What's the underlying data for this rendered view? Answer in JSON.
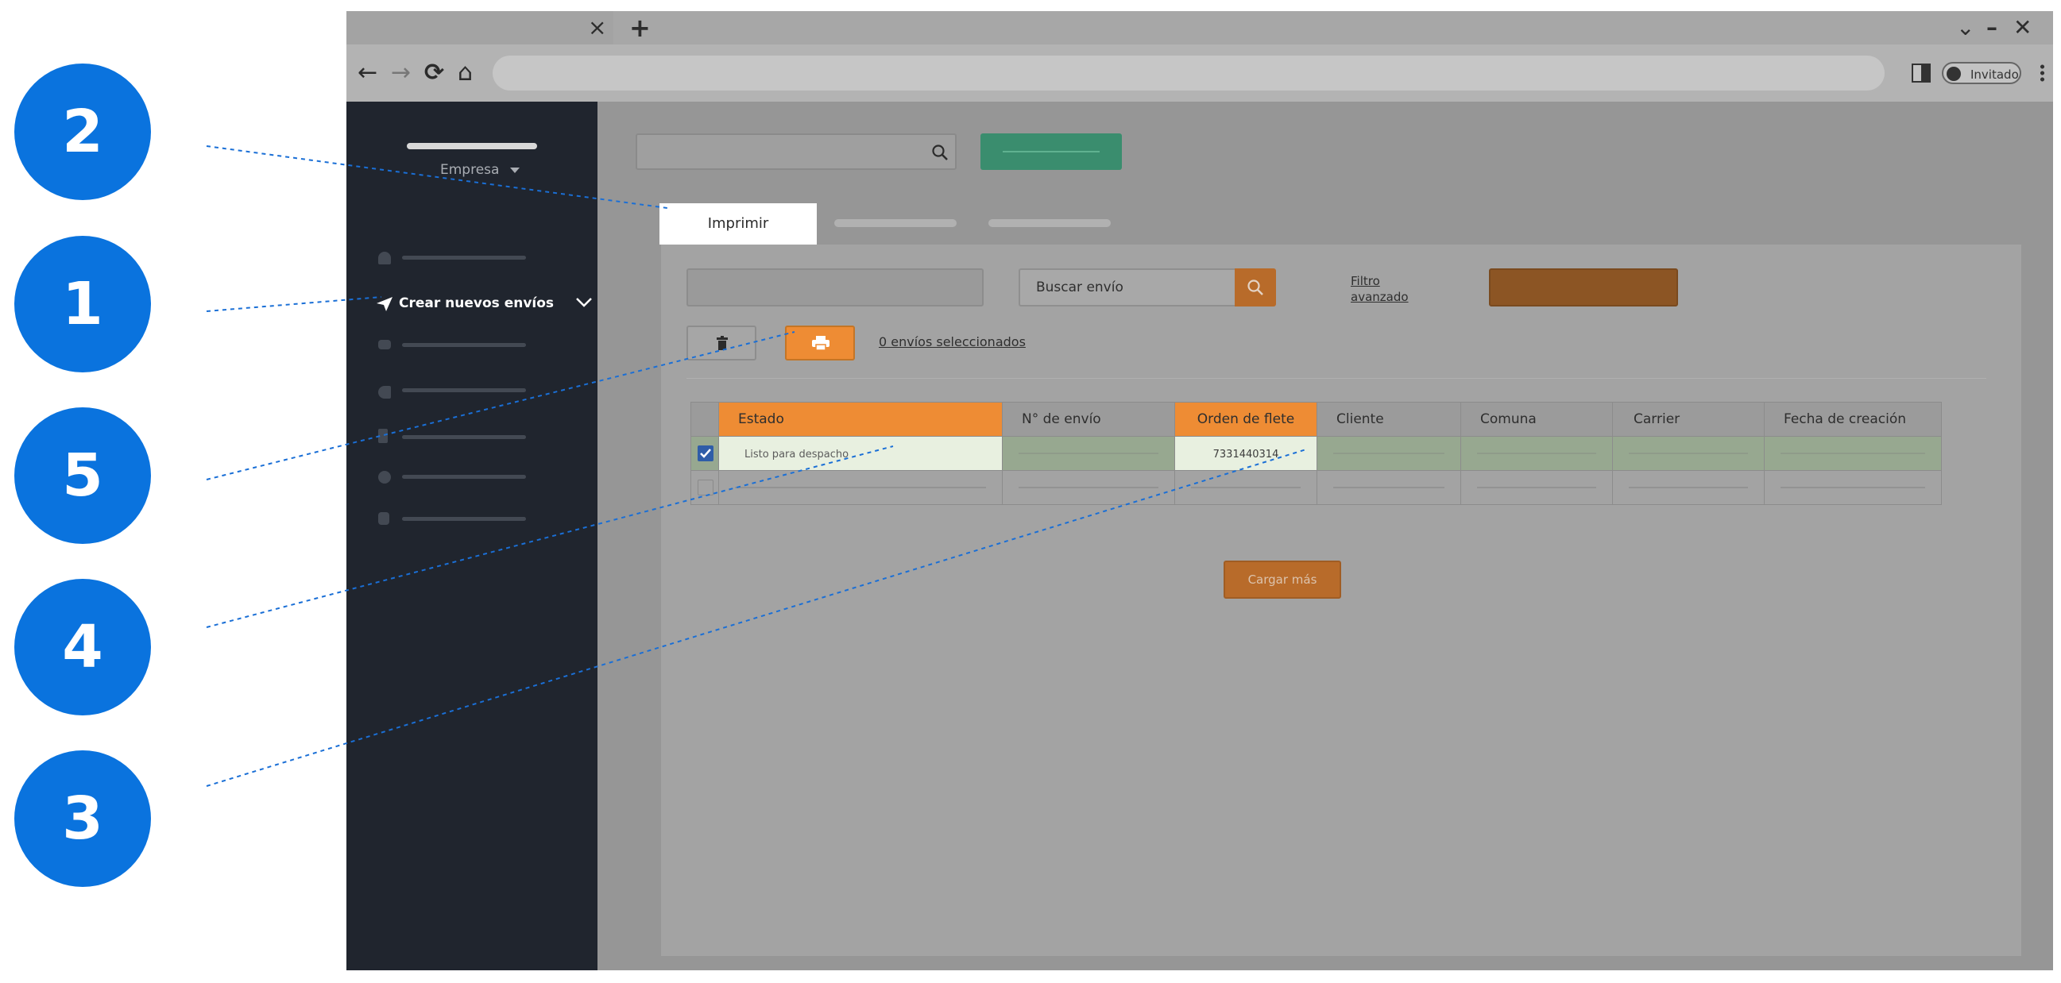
{
  "callouts": [
    "2",
    "1",
    "5",
    "4",
    "3"
  ],
  "colors": {
    "callout": "#0a73de",
    "sidebar": "#20252e",
    "accent_orange": "#ee8c34",
    "dark_orange": "#8c5524",
    "green_button": "#3a8d6e"
  },
  "browser": {
    "close_tab_icon": "×",
    "new_tab_icon": "+",
    "window_controls": [
      "⌄",
      "–",
      "✕"
    ],
    "nav_icons": [
      "←",
      "→",
      "⟳",
      "⌂"
    ],
    "profile_label": "Invitado"
  },
  "sidebar": {
    "company_label": "Empresa",
    "company_dropdown_icon": "caret-down-icon",
    "active_item_label": "Crear nuevos envíos"
  },
  "tabs": {
    "active_label": "Imprimir"
  },
  "toolbar": {
    "search_placeholder": "Buscar envío",
    "advanced_filter_label": "Filtro avanzado",
    "selected_count_label": "0 envíos seleccionados"
  },
  "table": {
    "columns": [
      "Estado",
      "N° de envío",
      "Orden de flete",
      "Cliente",
      "Comuna",
      "Carrier",
      "Fecha de creación"
    ],
    "rows": [
      {
        "checked": true,
        "estado": "Listo para despacho",
        "orden_flete": "7331440314"
      },
      {
        "checked": false,
        "estado": "",
        "orden_flete": ""
      }
    ]
  },
  "load_more_label": "Cargar más"
}
